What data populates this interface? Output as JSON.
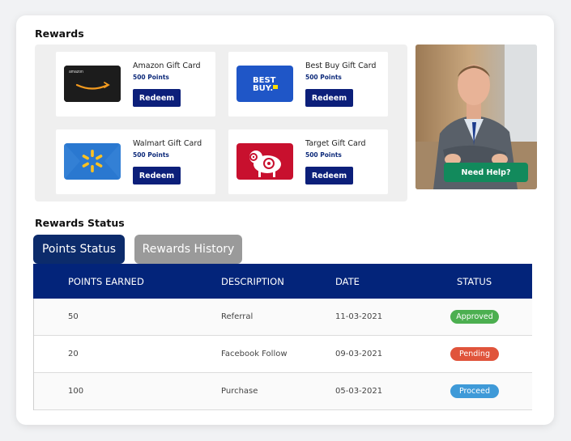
{
  "rewards": {
    "title": "Rewards",
    "redeem_label": "Redeem",
    "cards": [
      {
        "name": "Amazon Gift Card",
        "points": "500 Points"
      },
      {
        "name": "Best Buy Gift Card",
        "points": "500 Points"
      },
      {
        "name": "Walmart Gift Card",
        "points": "500 Points"
      },
      {
        "name": "Target Gift Card",
        "points": "500 Points"
      }
    ],
    "help_label": "Need Help?"
  },
  "status": {
    "title": "Rewards Status",
    "tabs": [
      {
        "label": "Points Status",
        "active": true
      },
      {
        "label": "Rewards History",
        "active": false
      }
    ],
    "columns": [
      "POINTS EARNED",
      "DESCRIPTION",
      "DATE",
      "STATUS"
    ],
    "rows": [
      {
        "points": "50",
        "description": "Referral",
        "date": "11-03-2021",
        "status": "Approved",
        "status_color": "#4caf50"
      },
      {
        "points": "20",
        "description": "Facebook Follow",
        "date": "09-03-2021",
        "status": "Pending",
        "status_color": "#e0543b"
      },
      {
        "points": "100",
        "description": "Purchase",
        "date": "05-03-2021",
        "status": "Proceed",
        "status_color": "#3f9ad8"
      }
    ]
  },
  "logos": {
    "amazon": "amazon",
    "bestbuy_line1": "BEST",
    "bestbuy_line2": "BUY."
  },
  "colors": {
    "navy": "#03247a",
    "button": "#0c1f7a",
    "help": "#128a5c"
  }
}
